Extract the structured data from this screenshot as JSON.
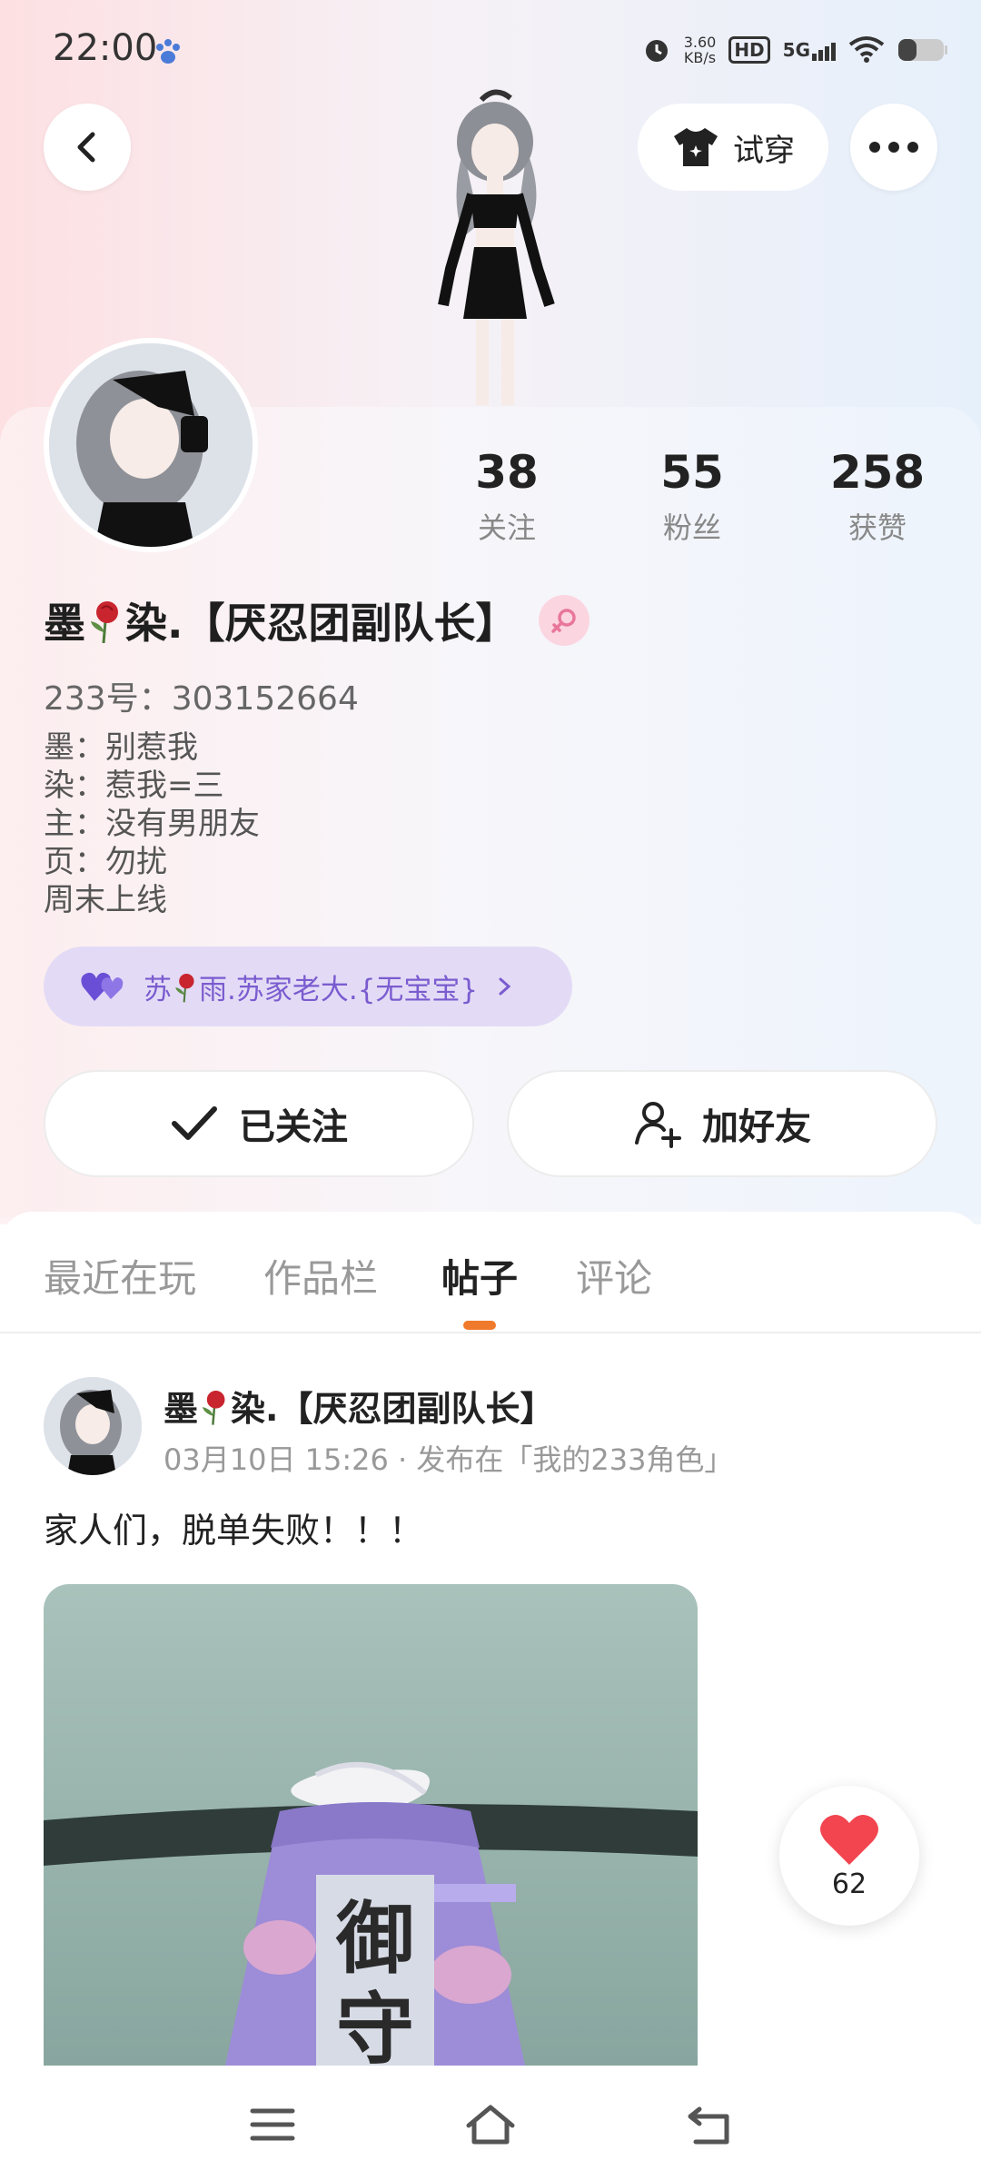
{
  "status_bar": {
    "time": "22:00",
    "net_speed_value": "3.60",
    "net_speed_unit": "KB/s",
    "hd_label": "HD",
    "network_label": "5G"
  },
  "header": {
    "tryon_label": "试穿"
  },
  "stats": [
    {
      "value": "38",
      "label": "关注"
    },
    {
      "value": "55",
      "label": "粉丝"
    },
    {
      "value": "258",
      "label": "获赞"
    }
  ],
  "profile": {
    "name_prefix": "墨",
    "name_suffix": "染.【厌忍团副队长】",
    "uid": "233号：303152664",
    "bio": [
      "墨：别惹我",
      "染：惹我=三",
      "主：没有男朋友",
      "页：勿扰",
      "周末上线"
    ]
  },
  "partner": {
    "name_prefix": "苏",
    "name_suffix": "雨.苏家老大.{无宝宝}"
  },
  "actions": {
    "followed_label": "已关注",
    "add_friend_label": "加好友"
  },
  "tabs": [
    {
      "label": "最近在玩",
      "active": false
    },
    {
      "label": "作品栏",
      "active": false
    },
    {
      "label": "帖子",
      "active": true
    },
    {
      "label": "评论",
      "active": false
    }
  ],
  "post": {
    "author_prefix": "墨",
    "author_suffix": "染.【厌忍团副队长】",
    "meta": "03月10日 15:26 · 发布在「我的233角色」",
    "text": "家人们，脱单失败！！！",
    "image_text": "御守",
    "like_count": "62"
  },
  "colors": {
    "accent_orange": "#f07a2b",
    "partner_purple": "#7a5ccf",
    "like_red": "#f2454f"
  }
}
